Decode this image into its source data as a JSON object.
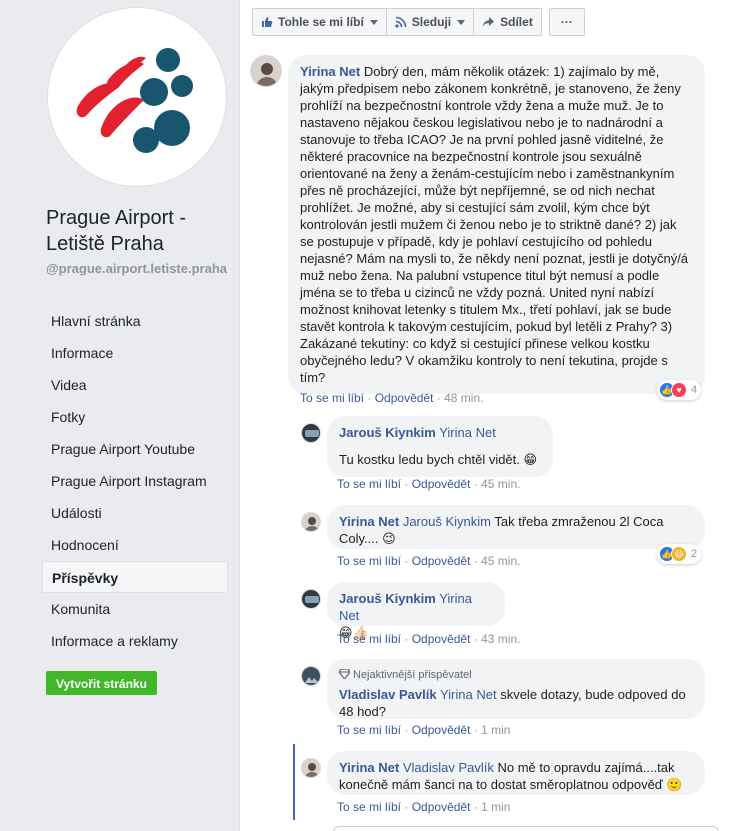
{
  "sidebar": {
    "page_name": "Prague Airport - Letiště Praha",
    "handle": "@prague.airport.letiste.praha",
    "nav": [
      {
        "label": "Hlavní stránka",
        "active": false
      },
      {
        "label": "Informace",
        "active": false
      },
      {
        "label": "Videa",
        "active": false
      },
      {
        "label": "Fotky",
        "active": false
      },
      {
        "label": "Prague Airport Youtube",
        "active": false
      },
      {
        "label": "Prague Airport Instagram",
        "active": false
      },
      {
        "label": "Události",
        "active": false
      },
      {
        "label": "Hodnocení",
        "active": false
      },
      {
        "label": "Příspěvky",
        "active": true
      },
      {
        "label": "Komunita",
        "active": false
      },
      {
        "label": "Informace a reklamy",
        "active": false
      }
    ],
    "create_page_label": "Vytvořit stránku"
  },
  "actionbar": {
    "like_label": "Tohle se mi líbí",
    "follow_label": "Sleduji",
    "share_label": "Sdílet",
    "more_label": "···"
  },
  "colors": {
    "link": "#385898",
    "bubble": "#f2f3f5",
    "sidebar_bg": "#e9ebee",
    "create_button": "#42b72a",
    "logo_red": "#e2202e",
    "logo_teal": "#17566e"
  },
  "comment_actions": {
    "like": "To se mi líbí",
    "reply": "Odpovědět",
    "separator": "·"
  },
  "comments": [
    {
      "author": "Yirina Net",
      "mention": "",
      "text": "Dobrý den, mám několik otázek: 1) zajímalo by mě, jakým předpisem nebo zákonem konkrétně, je stanoveno, že ženy prohlíží na bezpečnostní kontrole vždy žena a muže muž. Je to nastaveno nějakou českou legislativou nebo je to nadnárodní a stanovuje to třeba ICAO? Je na první pohled jasně viditelné, že některé pracovnice na bezpečnostní kontrole jsou sexuálně orientované na ženy a ženám-cestujícím nebo i zaměstnankyním přes ně procházející, může být nepříjemné, se od nich nechat prohlížet. Je možné, aby si cestující sám zvolil, kým chce být kontrolován jestli mužem či ženou nebo je to striktně dané? 2) jak se postupuje v případě, kdy je pohlaví cestujícího od pohledu nejasné? Mám na mysli to, že někdy není poznat, jestli je dotyčný/á muž nebo žena. Na palubní vstupence titul být nemusí a podle jména se to třeba u cizinců ne vždy pozná. United nyní nabízí možnost knihovat letenky s titulem Mx., třetí pohlaví, jak se bude stavět kontrola k takovým cestujícím, pokud byl letěli z Prahy? 3) Zakázané tekutiny: co když si cestující přinese velkou kostku obyčejného ledu? V okamžiku kontroly to není tekutina, projde s tím?",
      "time": "48 min.",
      "reactions": {
        "count": "4",
        "icons": [
          "like",
          "heart"
        ]
      }
    },
    {
      "author": "Jarouš Kiynkim",
      "mention": "Yirina Net",
      "text": "Tu kostku ledu bych chtěl vidět. 😁",
      "time": "45 min."
    },
    {
      "author": "Yirina Net",
      "mention": "Jarouš Kiynkim",
      "text": "Tak třeba zmraženou 2l Coca Coly.... 😉",
      "time": "45 min.",
      "reactions": {
        "count": "2",
        "icons": [
          "like",
          "haha"
        ]
      }
    },
    {
      "author": "Jarouš Kiynkim",
      "mention": "Yirina Net",
      "text": "😁👍🏻",
      "time": "43 min."
    },
    {
      "badge": "Nejaktivnější přispěvatel",
      "author": "Vladislav Pavlík",
      "mention": "Yirina Net",
      "text": "skvele dotazy, bude odpoved do 48 hod?",
      "time": "1 min"
    },
    {
      "author": "Yirina Net",
      "mention": "Vladislav Pavlík",
      "text": "No mě to opravdu zajímá....tak konečně mám šanci na to dostat směroplatnou odpověď 🙂",
      "time": "1 min"
    }
  ]
}
